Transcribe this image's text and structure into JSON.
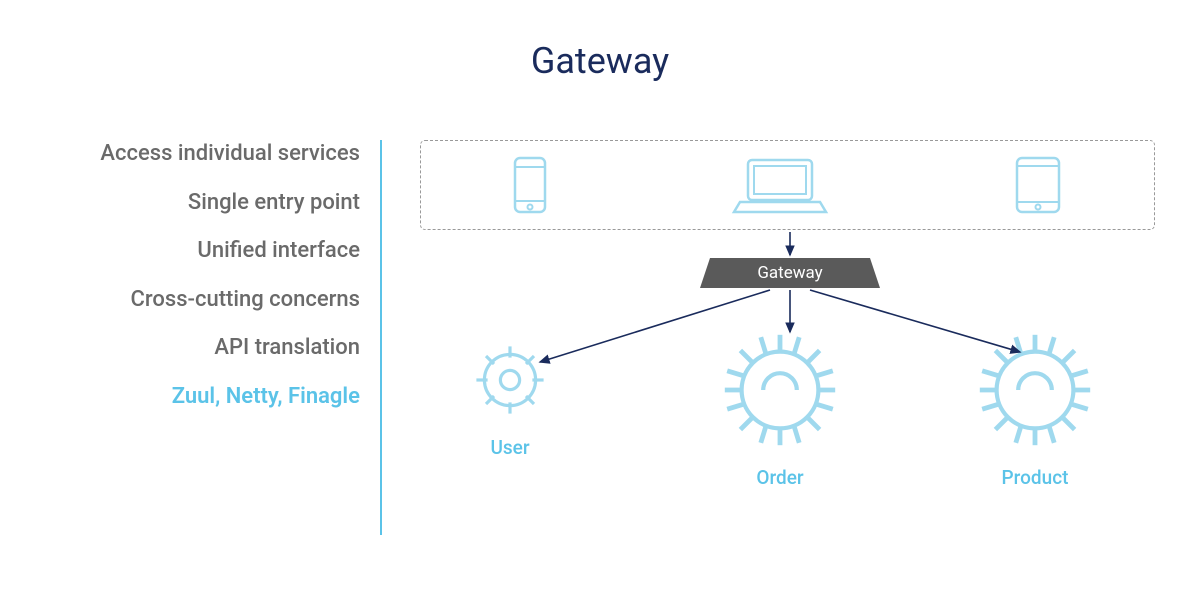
{
  "title": "Gateway",
  "bullets": [
    {
      "text": "Access individual services",
      "highlight": false
    },
    {
      "text": "Single entry point",
      "highlight": false
    },
    {
      "text": "Unified interface",
      "highlight": false
    },
    {
      "text": "Cross-cutting concerns",
      "highlight": false
    },
    {
      "text": "API translation",
      "highlight": false
    },
    {
      "text": "Zuul, Netty, Finagle",
      "highlight": true
    }
  ],
  "gateway_label": "Gateway",
  "clients": [
    "phone",
    "laptop",
    "tablet"
  ],
  "services": [
    {
      "id": "user",
      "label": "User",
      "size": "small"
    },
    {
      "id": "order",
      "label": "Order",
      "size": "large"
    },
    {
      "id": "product",
      "label": "Product",
      "size": "large"
    }
  ],
  "colors": {
    "accent": "#5bc3e8",
    "title": "#1a2b5c",
    "muted": "#6a6a6a",
    "box": "#5a5a5a",
    "arrow": "#1a2b5c"
  }
}
